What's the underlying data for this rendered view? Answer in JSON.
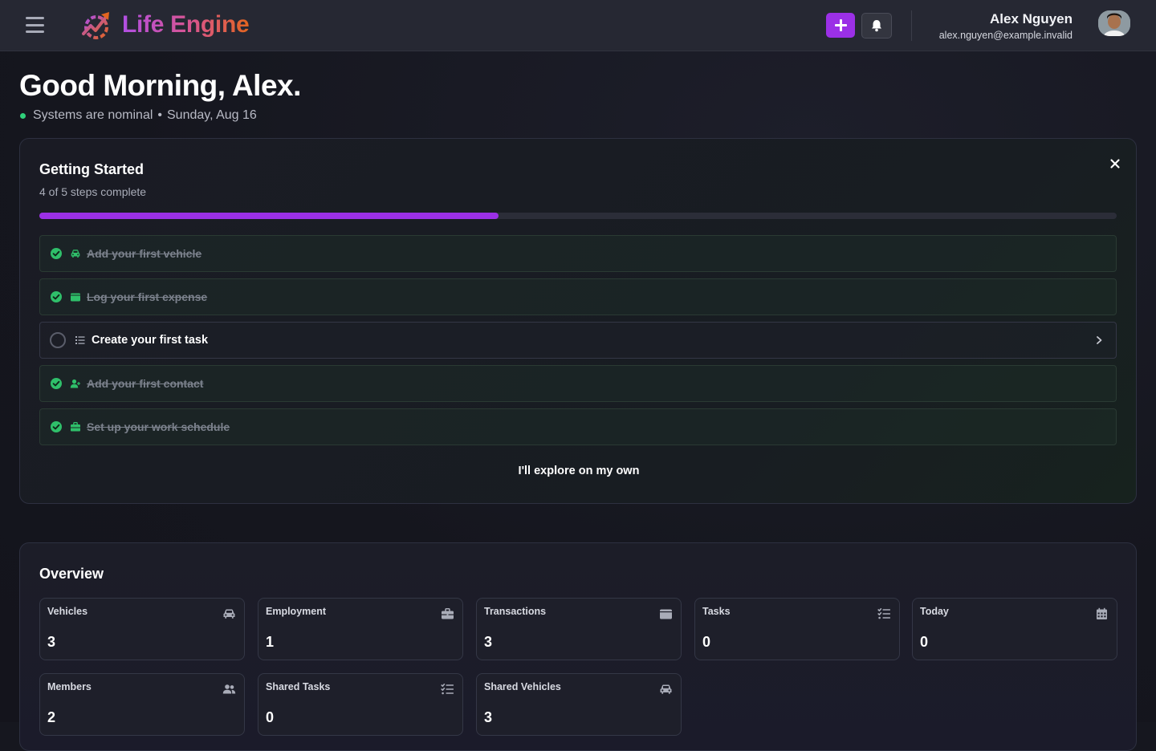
{
  "app": {
    "brand": "Life Engine",
    "accent_color": "#9b30e6",
    "status_color": "#2fd07a"
  },
  "header": {
    "menu_icon": "hamburger-icon",
    "add_icon": "plus-icon",
    "bell_icon": "bell-icon",
    "user": {
      "name": "Alex Nguyen",
      "email": "alex.nguyen@example.invalid"
    }
  },
  "greeting": {
    "title": "Good Morning, Alex.",
    "status": "Systems are nominal",
    "separator": "•",
    "date": "Sunday, Aug 16"
  },
  "getting_started": {
    "title": "Getting Started",
    "subtitle": "4 of 5 steps complete",
    "progress": 0.426,
    "steps": [
      {
        "label": "Add your first vehicle",
        "done": true,
        "icon": "car-icon"
      },
      {
        "label": "Log your first expense",
        "done": true,
        "icon": "wallet-icon"
      },
      {
        "label": "Create your first task",
        "done": false,
        "icon": "tasks-icon"
      },
      {
        "label": "Add your first contact",
        "done": true,
        "icon": "user-plus-icon"
      },
      {
        "label": "Set up your work schedule",
        "done": true,
        "icon": "briefcase-icon"
      }
    ],
    "dismiss_label": "I'll explore on my own"
  },
  "overview": {
    "title": "Overview",
    "stats": [
      {
        "label": "Vehicles",
        "value": "3",
        "icon": "car-icon"
      },
      {
        "label": "Employment",
        "value": "1",
        "icon": "briefcase-icon"
      },
      {
        "label": "Transactions",
        "value": "3",
        "icon": "wallet-icon"
      },
      {
        "label": "Tasks",
        "value": "0",
        "icon": "tasks-icon"
      },
      {
        "label": "Today",
        "value": "0",
        "icon": "calendar-icon"
      },
      {
        "label": "Members",
        "value": "2",
        "icon": "users-icon"
      },
      {
        "label": "Shared Tasks",
        "value": "0",
        "icon": "tasks-icon"
      },
      {
        "label": "Shared Vehicles",
        "value": "3",
        "icon": "car-icon"
      }
    ]
  }
}
